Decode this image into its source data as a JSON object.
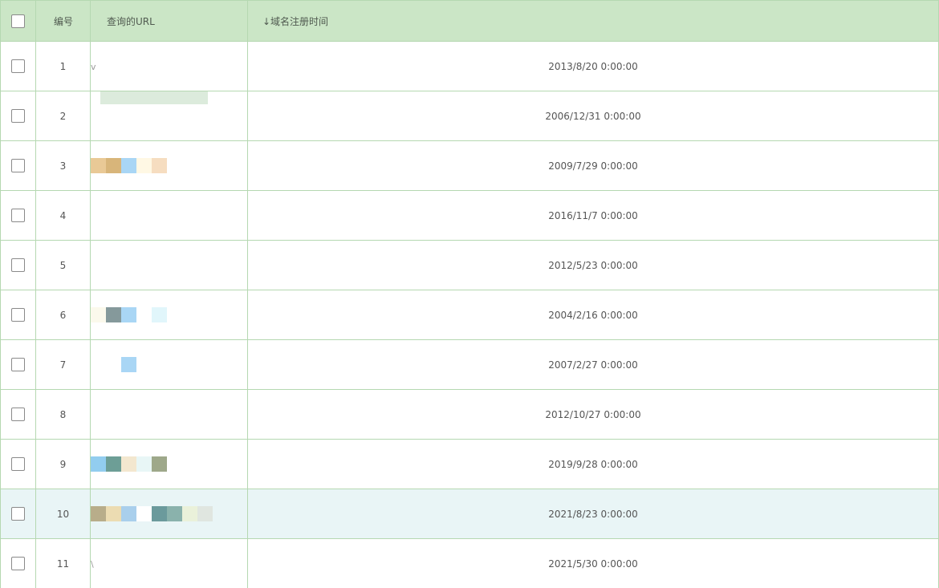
{
  "header": {
    "number_label": "编号",
    "url_label": "查询的URL",
    "date_label": "↓域名注册时间"
  },
  "rows": [
    {
      "num": "1",
      "url": "v",
      "date": "2013/8/20 0:00:00",
      "pixels": []
    },
    {
      "num": "2",
      "url": "",
      "date": "2006/12/31 0:00:00",
      "pixels": []
    },
    {
      "num": "3",
      "url": "",
      "date": "2009/7/29 0:00:00",
      "pixels": [
        "#e9c996",
        "#d8b57a",
        "#a9d6f5",
        "#fff8e4",
        "#f6ddc0"
      ]
    },
    {
      "num": "4",
      "url": "",
      "date": "2016/11/7 0:00:00",
      "pixels": []
    },
    {
      "num": "5",
      "url": "",
      "date": "2012/5/23 0:00:00",
      "pixels": []
    },
    {
      "num": "6",
      "url": "",
      "date": "2004/2/16 0:00:00",
      "pixels": [
        "#fbf9ec",
        "#85999b",
        "#a9d6f5",
        "#ffffff",
        "#e1f6fb"
      ]
    },
    {
      "num": "7",
      "url": "",
      "date": "2007/2/27 0:00:00",
      "pixels": [
        "#ffffff",
        "#ffffff",
        "#a9d6f5"
      ]
    },
    {
      "num": "8",
      "url": "",
      "date": "2012/10/27 0:00:00",
      "pixels": []
    },
    {
      "num": "9",
      "url": "",
      "date": "2019/9/28 0:00:00",
      "pixels": [
        "#92cdef",
        "#6d9e96",
        "#f3e7cf",
        "#e8f6f6",
        "#9ea88a"
      ]
    },
    {
      "num": "10",
      "url": "",
      "date": "2021/8/23 0:00:00",
      "pixels": [
        "#b8ad8a",
        "#ecdcb2",
        "#a9cfec",
        "#ffffff",
        "#6b9a9c",
        "#8ab2ac",
        "#eaf1da",
        "#e0e6e0"
      ],
      "highlighted": true
    },
    {
      "num": "11",
      "url": "\\",
      "date": "2021/5/30 0:00:00",
      "pixels": []
    }
  ],
  "colors": {
    "header_bg": "#cbe6c6",
    "border": "#b5d8b1",
    "highlight_row": "#e9f5f6"
  }
}
